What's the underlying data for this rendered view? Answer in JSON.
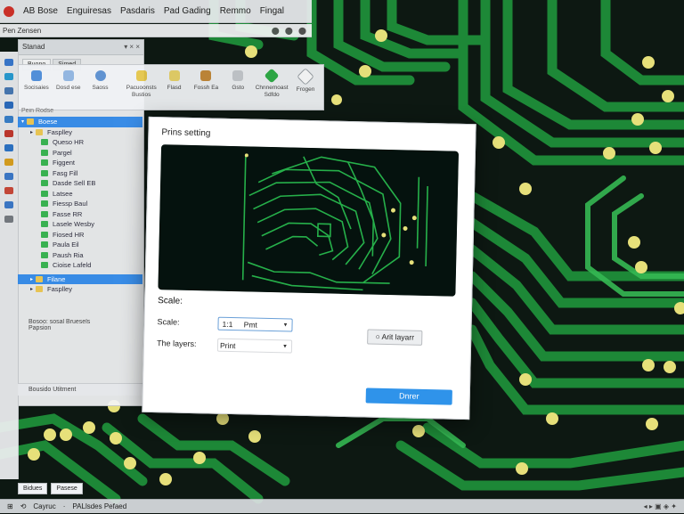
{
  "menubar": {
    "items": [
      "AB Bose",
      "Enguiresas",
      "Pasdaris",
      "Pad Gading",
      "Remmo",
      "Fingal"
    ]
  },
  "addressbar": {
    "text": "Pen Zensen",
    "dots": "⬤ ⬤ ⬤"
  },
  "panel": {
    "title": "Stanad",
    "tabs": [
      "Buono",
      "Simed"
    ],
    "buttons": "▾ × ×"
  },
  "ribbon": {
    "buttons": [
      {
        "label": "Socisaies",
        "icon": "blue-tool-icon"
      },
      {
        "label": "Dosd ese",
        "icon": "doc-tool-icon"
      },
      {
        "label": "Saoss",
        "icon": "search-icon"
      },
      {
        "label": "Pacuoonsts Bustios",
        "icon": "yellow-doc-icon"
      },
      {
        "label": "Flasd",
        "icon": "yellow-doc-icon"
      },
      {
        "label": "Fossh Ea",
        "icon": "chip-icon"
      },
      {
        "label": "Gsto",
        "icon": "gray-doc-icon"
      },
      {
        "label": "Chnnemoast Sdfdo",
        "icon": "green-diamond-icon"
      },
      {
        "label": "Frogen",
        "icon": "outline-diamond-icon"
      }
    ]
  },
  "tree": {
    "header": "Pein Rodse",
    "rows": [
      {
        "label": "Boese",
        "selected": true
      },
      {
        "label": "Fasplley",
        "selected": false
      },
      {
        "label": "Queso HR",
        "selected": false
      },
      {
        "label": "Pargel",
        "selected": false
      },
      {
        "label": "Figgent",
        "selected": false
      },
      {
        "label": "Fasg Fill",
        "selected": false
      },
      {
        "label": "Dasde Sell EB",
        "selected": false
      },
      {
        "label": "Latsee",
        "selected": false
      },
      {
        "label": "Fiessp Baul",
        "selected": false
      },
      {
        "label": "Fasse RR",
        "selected": false
      },
      {
        "label": "Lasele Wesby",
        "selected": false
      },
      {
        "label": "Fiosed HR",
        "selected": false
      },
      {
        "label": "Paula Eil",
        "selected": false
      },
      {
        "label": "Paush Ria",
        "selected": false
      },
      {
        "label": "Cioise Lafeld",
        "selected": false
      },
      {
        "label": "Filane",
        "selected": true
      },
      {
        "label": "Fasplley",
        "selected": false
      }
    ],
    "footer": "Bosoo: sosal Bruesels",
    "section": "Papsion"
  },
  "panel_bottom": {
    "text": "Bousido Utitment"
  },
  "bottom_tabs": [
    "Bidues",
    "Pasese"
  ],
  "statusbar": {
    "left": [
      "⊞",
      "⟲",
      "Cayruc",
      "·",
      "PALlsdes Pefaed"
    ],
    "right": "◂ ▸ ▣ ◈ ✦"
  },
  "dialog": {
    "title": "Prins setting",
    "scale_header": "Scale:",
    "scale_label": "Scale:",
    "scale_value_num": "1:1",
    "scale_value_text": "Pmt",
    "layers_label": "The layers:",
    "layers_value": "Print",
    "option_button": "Arit layarr",
    "option_icon": "○",
    "primary_button": "Dnrer"
  },
  "colors": {
    "trace": "#1f9a3a",
    "trace_bright": "#35c65a",
    "pad": "#e9e27c",
    "primary": "#2f93ea"
  }
}
